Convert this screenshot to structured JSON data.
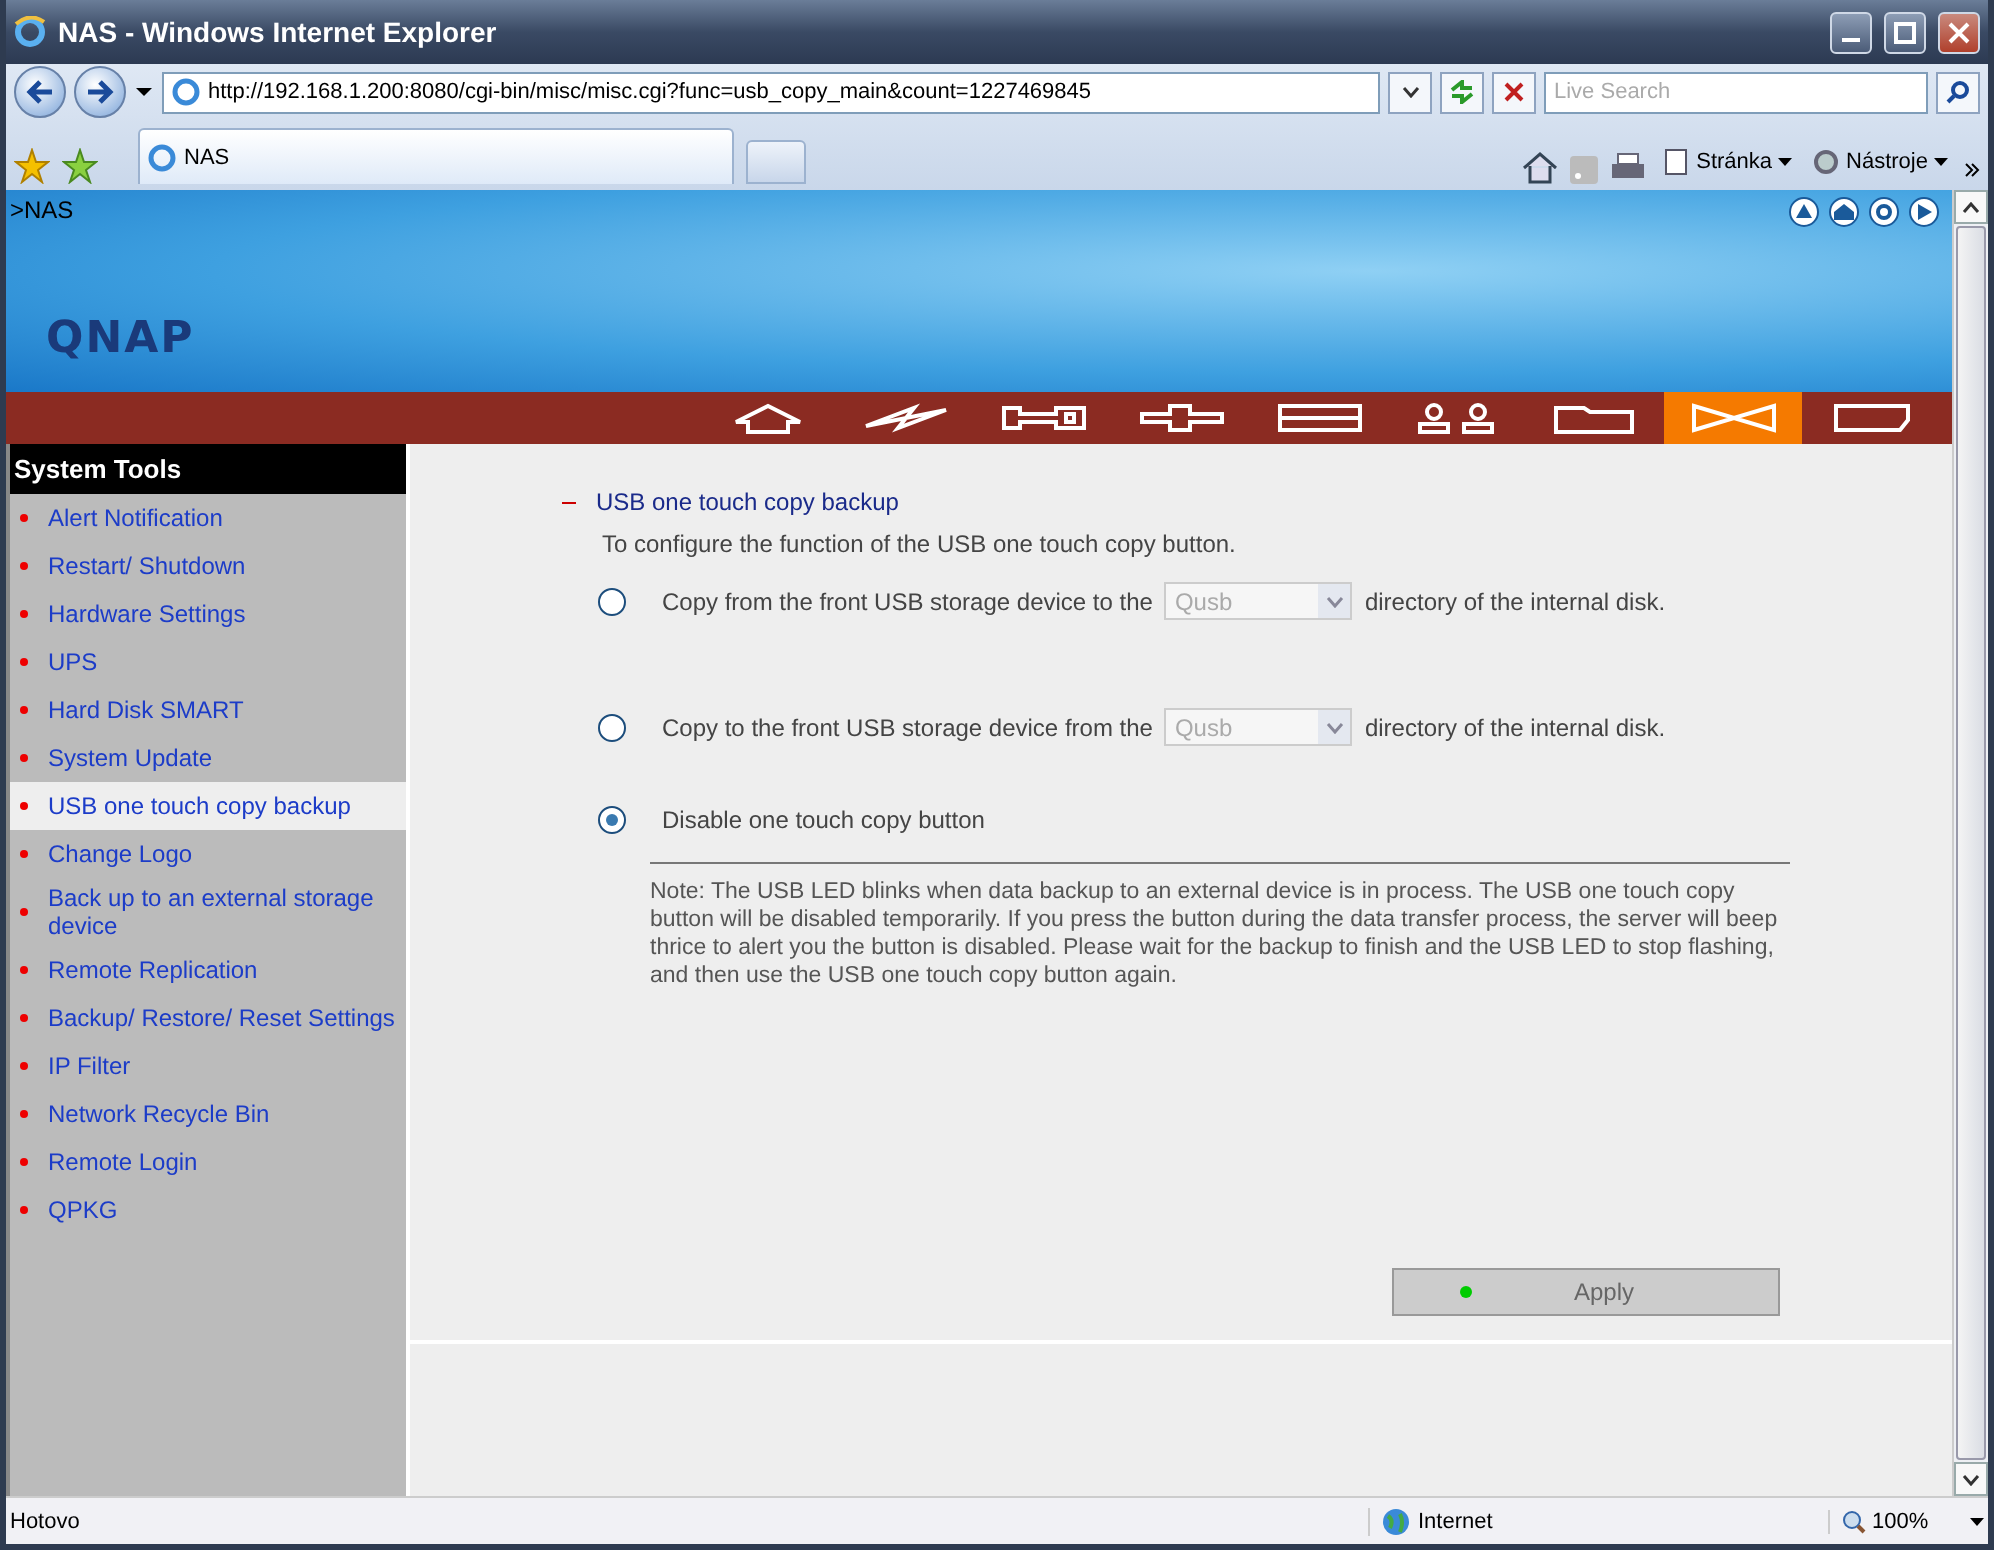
{
  "window": {
    "title": "NAS - Windows Internet Explorer"
  },
  "address_bar": {
    "url": "http://192.168.1.200:8080/cgi-bin/misc/misc.cgi?func=usb_copy_main&count=1227469845",
    "search_placeholder": "Live Search"
  },
  "tab": {
    "title": "NAS"
  },
  "commands": [
    {
      "label": "Stránka"
    },
    {
      "label": "Nástroje"
    }
  ],
  "banner": {
    "breadcrumb": ">NAS",
    "logo": "QNAP"
  },
  "nav_icons": [
    {
      "kind": "home",
      "selected": false
    },
    {
      "kind": "lightning",
      "selected": false
    },
    {
      "kind": "key",
      "selected": false
    },
    {
      "kind": "plus",
      "selected": false
    },
    {
      "kind": "panel",
      "selected": false
    },
    {
      "kind": "users",
      "selected": false
    },
    {
      "kind": "folder",
      "selected": false
    },
    {
      "kind": "bowtie",
      "selected": true
    },
    {
      "kind": "card",
      "selected": false
    }
  ],
  "sidebar": {
    "title": "System Tools",
    "items": [
      {
        "label": "Alert Notification",
        "selected": false
      },
      {
        "label": "Restart/ Shutdown",
        "selected": false
      },
      {
        "label": "Hardware Settings",
        "selected": false
      },
      {
        "label": "UPS",
        "selected": false
      },
      {
        "label": "Hard Disk SMART",
        "selected": false
      },
      {
        "label": "System Update",
        "selected": false
      },
      {
        "label": "USB one touch copy backup",
        "selected": true
      },
      {
        "label": "Change Logo",
        "selected": false
      },
      {
        "label": "Back up to an external storage device",
        "selected": false
      },
      {
        "label": "Remote Replication",
        "selected": false
      },
      {
        "label": "Backup/ Restore/ Reset Settings",
        "selected": false
      },
      {
        "label": "IP Filter",
        "selected": false
      },
      {
        "label": "Network Recycle Bin",
        "selected": false
      },
      {
        "label": "Remote Login",
        "selected": false
      },
      {
        "label": "QPKG",
        "selected": false
      }
    ]
  },
  "content": {
    "section_title": "USB one touch copy backup",
    "description": "To configure the function of the USB one touch copy button.",
    "options": [
      {
        "kind": "select",
        "before": "Copy from the front USB storage device to the",
        "select_value": "Qusb",
        "after": "directory of the internal disk.",
        "selected": false,
        "disabled": true
      },
      {
        "kind": "select",
        "before": "Copy to the front USB storage device from the",
        "select_value": "Qusb",
        "after": "directory of the internal disk.",
        "selected": false,
        "disabled": true
      },
      {
        "kind": "plain",
        "before": "Disable one touch copy button",
        "selected": true
      }
    ],
    "note": "Note: The USB LED blinks when data backup to an external device is in process. The USB one touch copy button will be disabled temporarily. If you press the button during the data transfer process, the server will beep thrice to alert you the button is disabled. Please wait for the backup to finish and the USB LED to stop flashing, and then use the USB one touch copy button again.",
    "apply_button": "Apply"
  },
  "status_bar": {
    "status": "Hotovo",
    "zone": "Internet",
    "zoom": "100%"
  }
}
